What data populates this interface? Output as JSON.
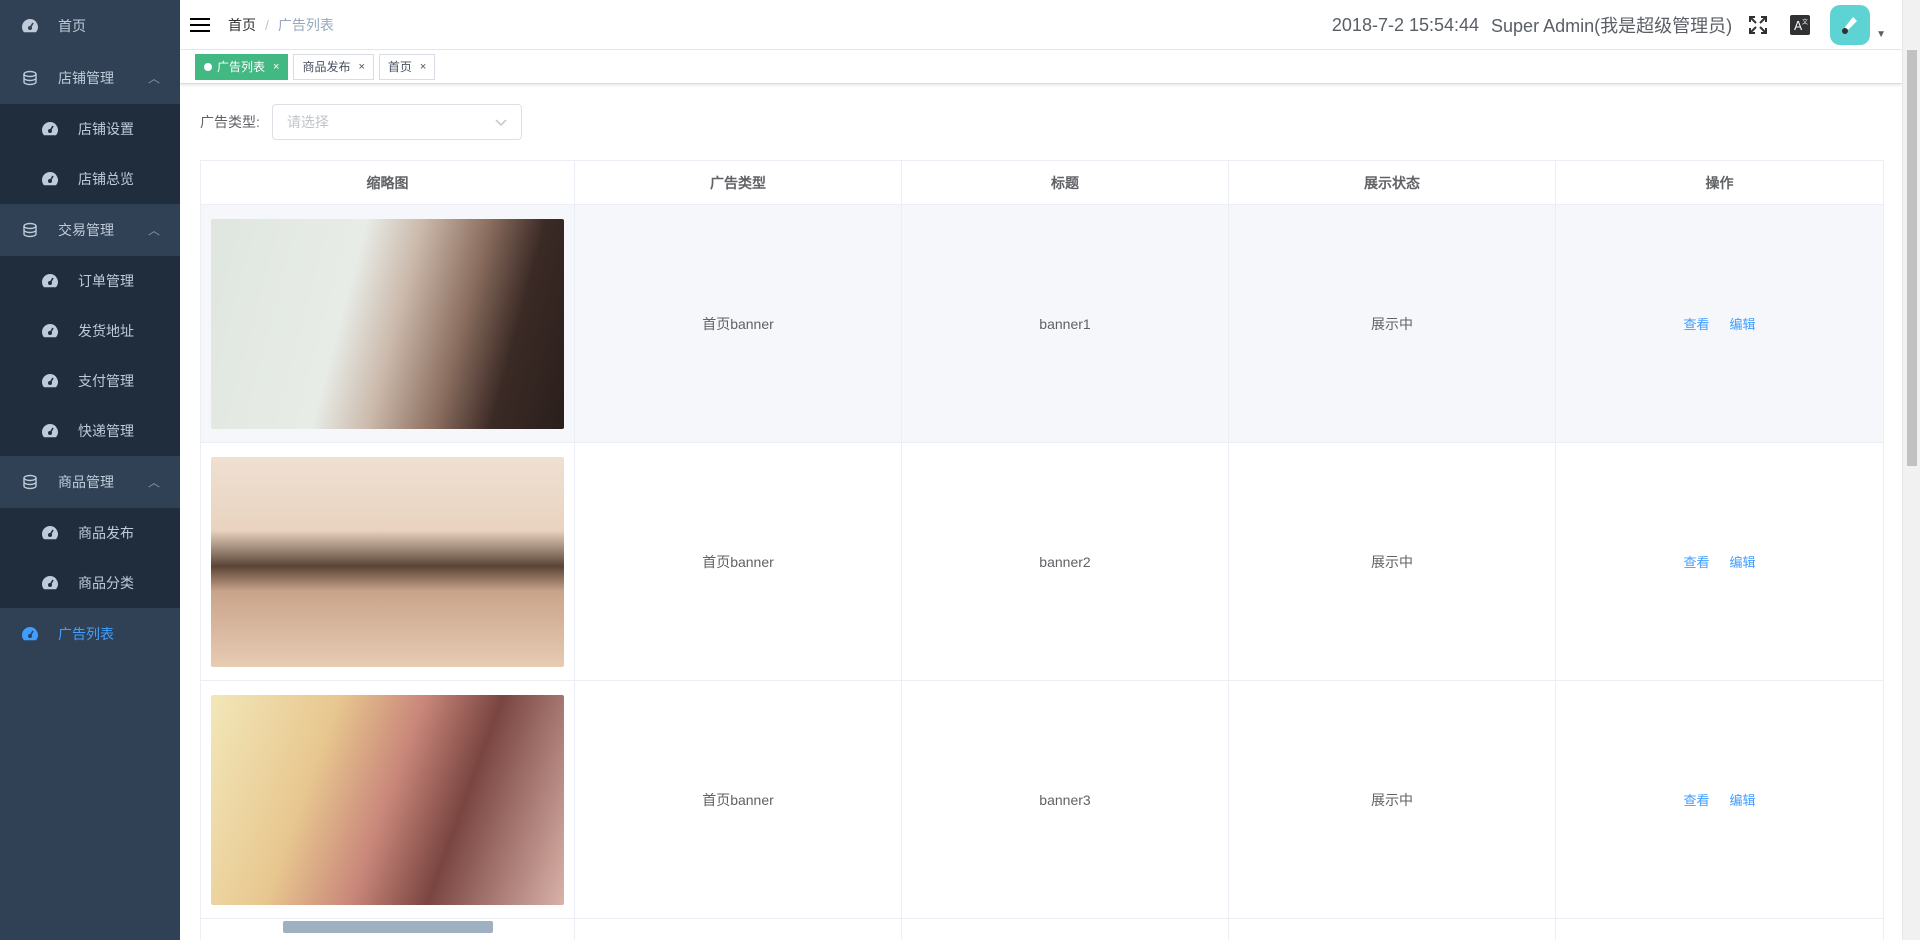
{
  "sidebar": {
    "items": [
      {
        "label": "首页"
      },
      {
        "label": "店铺管理",
        "children": [
          {
            "label": "店铺设置"
          },
          {
            "label": "店铺总览"
          }
        ]
      },
      {
        "label": "交易管理",
        "children": [
          {
            "label": "订单管理"
          },
          {
            "label": "发货地址"
          },
          {
            "label": "支付管理"
          },
          {
            "label": "快递管理"
          }
        ]
      },
      {
        "label": "商品管理",
        "children": [
          {
            "label": "商品发布"
          },
          {
            "label": "商品分类"
          }
        ]
      },
      {
        "label": "广告列表",
        "active": true
      }
    ]
  },
  "header": {
    "breadcrumb": [
      "首页",
      "广告列表"
    ],
    "datetime": "2018-7-2 15:54:44",
    "user": "Super Admin(我是超级管理员)"
  },
  "tags": [
    {
      "label": "广告列表",
      "active": true
    },
    {
      "label": "商品发布"
    },
    {
      "label": "首页"
    }
  ],
  "filter": {
    "label": "广告类型:",
    "placeholder": "请选择"
  },
  "table": {
    "headers": [
      "缩略图",
      "广告类型",
      "标题",
      "展示状态",
      "操作"
    ],
    "rows": [
      {
        "type": "首页banner",
        "title": "banner1",
        "status": "展示中",
        "view": "查看",
        "edit": "编辑"
      },
      {
        "type": "首页banner",
        "title": "banner2",
        "status": "展示中",
        "view": "查看",
        "edit": "编辑"
      },
      {
        "type": "首页banner",
        "title": "banner3",
        "status": "展示中",
        "view": "查看",
        "edit": "编辑"
      }
    ]
  },
  "colors": {
    "sidebar_bg": "#304156",
    "submenu_bg": "#1f2d3d",
    "active": "#409eff",
    "tag_active": "#42b983"
  }
}
